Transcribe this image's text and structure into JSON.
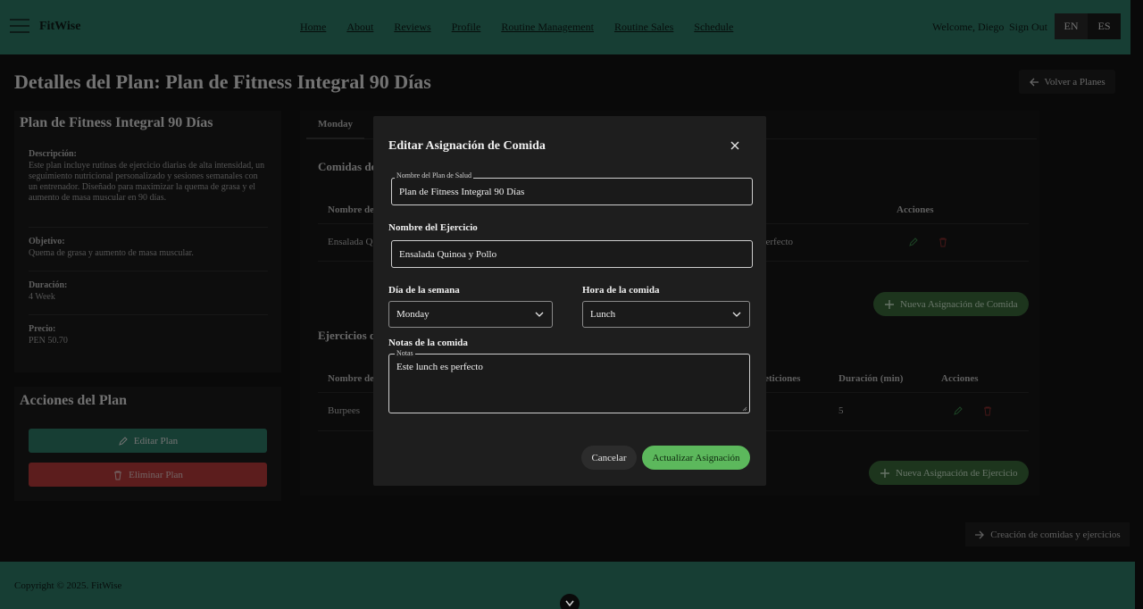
{
  "header": {
    "brand": "FitWise",
    "nav": [
      "Home",
      "About",
      "Reviews",
      "Profile",
      "Routine Management",
      "Routine Sales",
      "Schedule"
    ],
    "welcome": "Welcome, Diego",
    "sign_out": "Sign Out",
    "lang_en": "EN",
    "lang_es": "ES"
  },
  "page": {
    "title": "Detalles del Plan: Plan de Fitness Integral 90 Días",
    "back_label": "Volver a Planes"
  },
  "plan_card": {
    "title": "Plan de Fitness Integral 90 Días",
    "description_label": "Descripción:",
    "description": "Este plan incluye rutinas de ejercicio diarias de alta intensidad, un seguimiento nutricional personalizado y sesiones semanales con un entrenador. Diseñado para maximizar la quema de grasa y el aumento de masa muscular en 90 días.",
    "objective_label": "Objetivo:",
    "objective": "Quema de grasa y aumento de masa muscular.",
    "duration_label": "Duración:",
    "duration": "4 Week",
    "price_label": "Precio:",
    "price": "PEN 50.70"
  },
  "actions_card": {
    "title": "Acciones del Plan",
    "edit_label": "Editar Plan",
    "delete_label": "Eliminar Plan"
  },
  "tabs": {
    "active": "Monday"
  },
  "meals_section": {
    "title": "Comidas de",
    "col_name": "Nombre de",
    "col_actions": "Acciones",
    "row_name": "Ensalada Q",
    "row_notes": "perfecto",
    "new_button": "Nueva Asignación de Comida"
  },
  "exercises_section": {
    "title": "Ejercicios d",
    "col_name": "Nombre de",
    "col_reps": "peticiones",
    "col_duration": "Duración (min)",
    "col_actions": "Acciones",
    "row_name": "Burpees",
    "row_duration": "5",
    "new_button": "Nueva Asignación de Ejercicio"
  },
  "create_button": "Creación de comidas y ejercicios",
  "footer": {
    "copyright": "Copyright © 2025. FitWise"
  },
  "modal": {
    "title": "Editar Asignación de Comida",
    "plan_legend": "Nombre del Plan de Salud",
    "plan_value": "Plan de Fitness Integral 90 Días",
    "exercise_label": "Nombre del Ejercicio",
    "exercise_value": "Ensalada Quinoa y Pollo",
    "day_label": "Día de la semana",
    "day_value": "Monday",
    "meal_time_label": "Hora de la comida",
    "meal_time_value": "Lunch",
    "notes_label": "Notas de la comida",
    "notes_legend": "Notas",
    "notes_value": "Este lunch es perfecto",
    "cancel": "Cancelar",
    "update": "Actualizar Asignación"
  },
  "colors": {
    "brand_green": "#2e7d68",
    "success_green": "#5cb85c",
    "danger_red": "#b83a3a"
  }
}
